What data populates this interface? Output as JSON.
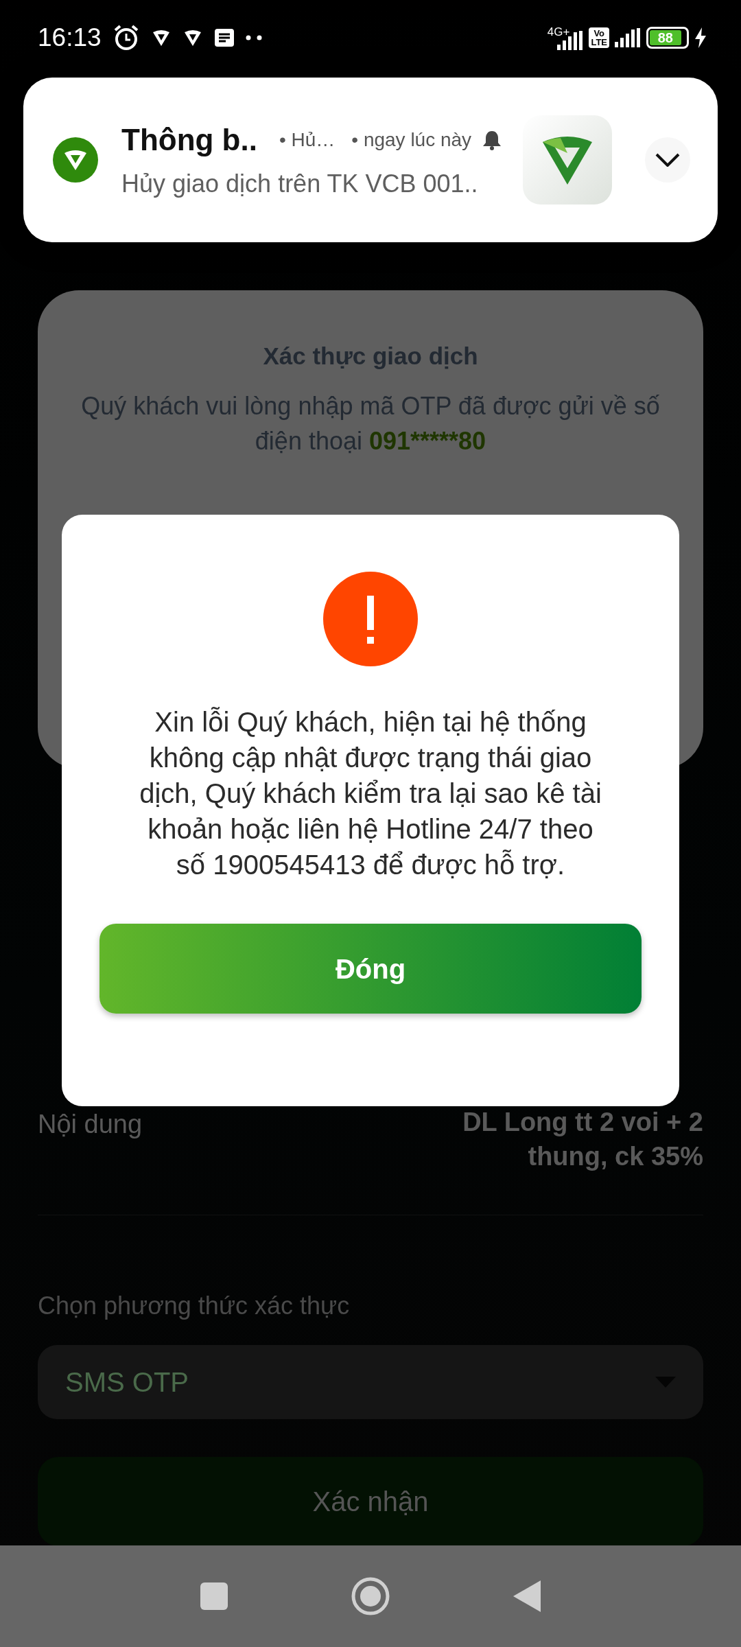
{
  "status_bar": {
    "time": "16:13",
    "network": "4G+",
    "volte": [
      "Vo",
      "LTE"
    ],
    "battery": "88"
  },
  "notification": {
    "title": "Thông b..",
    "subtext": "• Hủ…",
    "time": "• ngay lúc này",
    "body": "Hủy giao dịch trên TK VCB 001.."
  },
  "app": {
    "card": {
      "title": "Xác thực giao dịch",
      "message": "Quý khách vui lòng nhập mã OTP đã được gửi về số điện thoại",
      "phone": "091*****80"
    },
    "details": [
      {
        "label": "Nội dung",
        "value": "DL Long tt 2 voi + 2 thung, ck 35%"
      }
    ],
    "auth": {
      "label": "Chọn phương thức xác thực",
      "value": "SMS OTP"
    },
    "confirm_button": "Xác nhận"
  },
  "dialog": {
    "message": "Xin lỗi Quý khách, hiện tại hệ thống không cập nhật được trạng thái giao dịch, Quý khách kiểm tra lại sao kê tài khoản hoặc liên hệ Hotline 24/7 theo số 1900545413 để được hỗ trợ.",
    "button": "Đóng"
  }
}
